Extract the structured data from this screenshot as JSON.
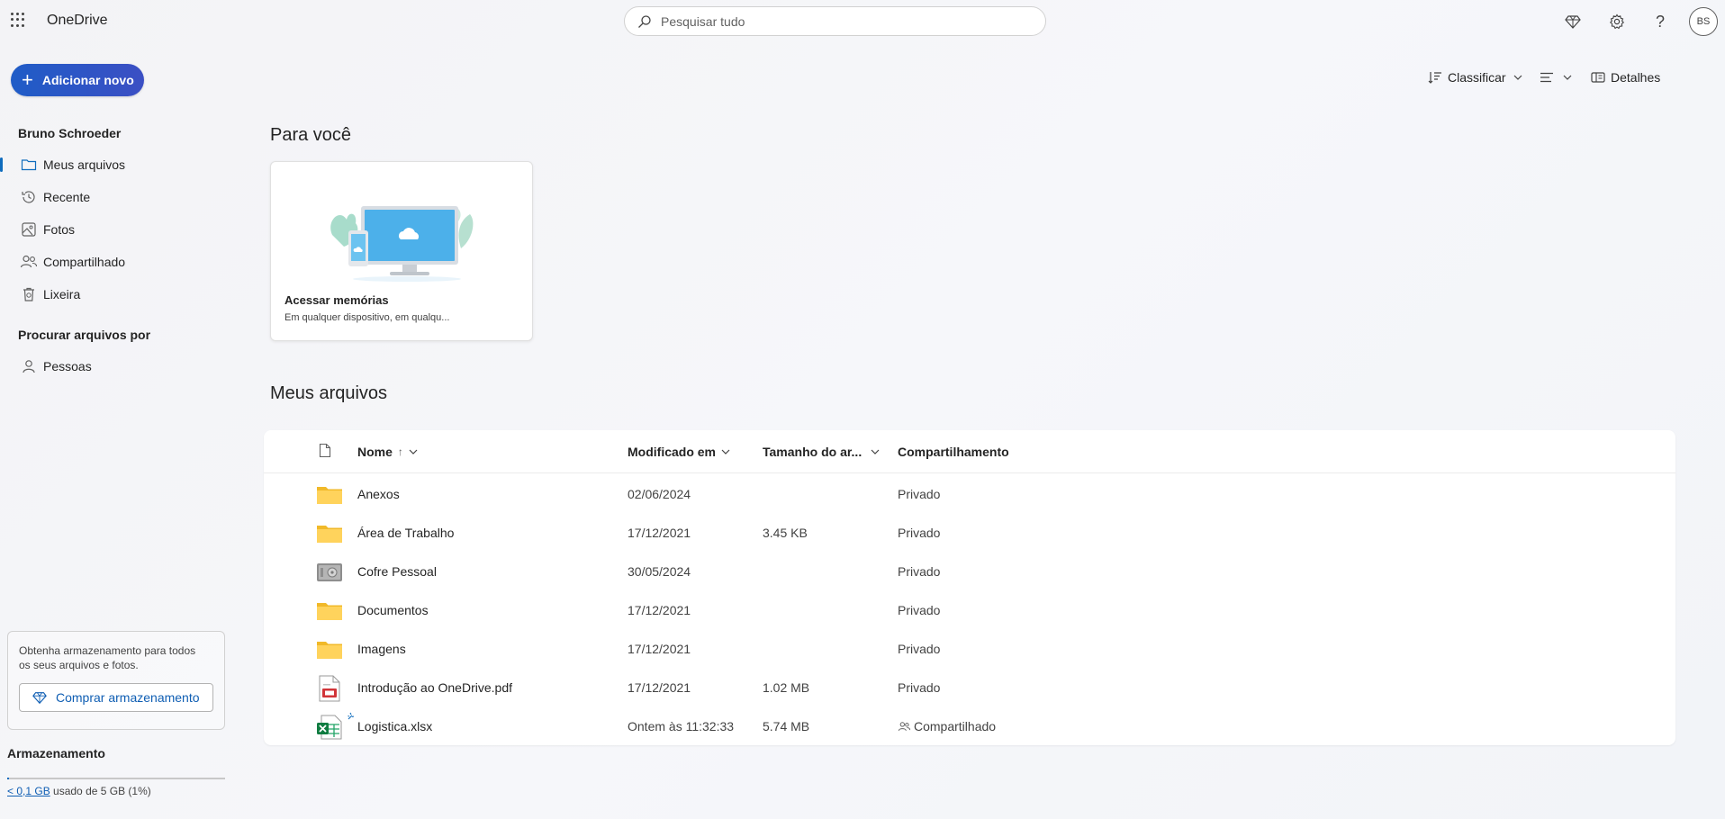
{
  "app": {
    "title": "OneDrive"
  },
  "search": {
    "placeholder": "Pesquisar tudo"
  },
  "topbar": {
    "icons": [
      "premium-diamond-icon",
      "settings-gear-icon",
      "help-question-icon"
    ],
    "avatar_initials": "BS"
  },
  "sidebar": {
    "add_button": "Adicionar novo",
    "user_name": "Bruno Schroeder",
    "items": [
      {
        "label": "Meus arquivos",
        "icon": "folder-icon",
        "active": true
      },
      {
        "label": "Recente",
        "icon": "history-icon"
      },
      {
        "label": "Fotos",
        "icon": "photo-icon"
      },
      {
        "label": "Compartilhado",
        "icon": "people-icon"
      },
      {
        "label": "Lixeira",
        "icon": "trash-icon"
      }
    ],
    "browse_label": "Procurar arquivos por",
    "browse_items": [
      {
        "label": "Pessoas",
        "icon": "person-icon"
      }
    ],
    "storage_promo": "Obtenha armazenamento para todos os seus arquivos e fotos.",
    "buy_button": "Comprar armazenamento",
    "storage_title": "Armazenamento",
    "storage_used_link": "< 0,1 GB",
    "storage_used_rest": " usado de 5 GB (1%)",
    "storage_fraction": 0.01
  },
  "commands": {
    "sort": "Classificar",
    "details": "Detalhes"
  },
  "main": {
    "for_you_title": "Para você",
    "card": {
      "title": "Acessar memórias",
      "subtitle": "Em qualquer dispositivo, em qualqu..."
    },
    "files_title": "Meus arquivos",
    "columns": {
      "name": "Nome",
      "sort_arrow": "↑",
      "modified": "Modificado em",
      "size": "Tamanho do ar...",
      "sharing": "Compartilhamento"
    },
    "files": [
      {
        "name": "Anexos",
        "type": "folder",
        "modified": "02/06/2024",
        "size": "",
        "sharing": "Privado"
      },
      {
        "name": "Área de Trabalho",
        "type": "folder",
        "modified": "17/12/2021",
        "size": "3.45 KB",
        "sharing": "Privado"
      },
      {
        "name": "Cofre Pessoal",
        "type": "vault",
        "modified": "30/05/2024",
        "size": "",
        "sharing": "Privado"
      },
      {
        "name": "Documentos",
        "type": "folder",
        "modified": "17/12/2021",
        "size": "",
        "sharing": "Privado"
      },
      {
        "name": "Imagens",
        "type": "folder",
        "modified": "17/12/2021",
        "size": "",
        "sharing": "Privado"
      },
      {
        "name": "Introdução ao OneDrive.pdf",
        "type": "pdf",
        "modified": "17/12/2021",
        "size": "1.02 MB",
        "sharing": "Privado"
      },
      {
        "name": "Logistica.xlsx",
        "type": "excel",
        "modified": "Ontem às 11:32:33",
        "size": "5.74 MB",
        "sharing": "Compartilhado"
      }
    ]
  }
}
